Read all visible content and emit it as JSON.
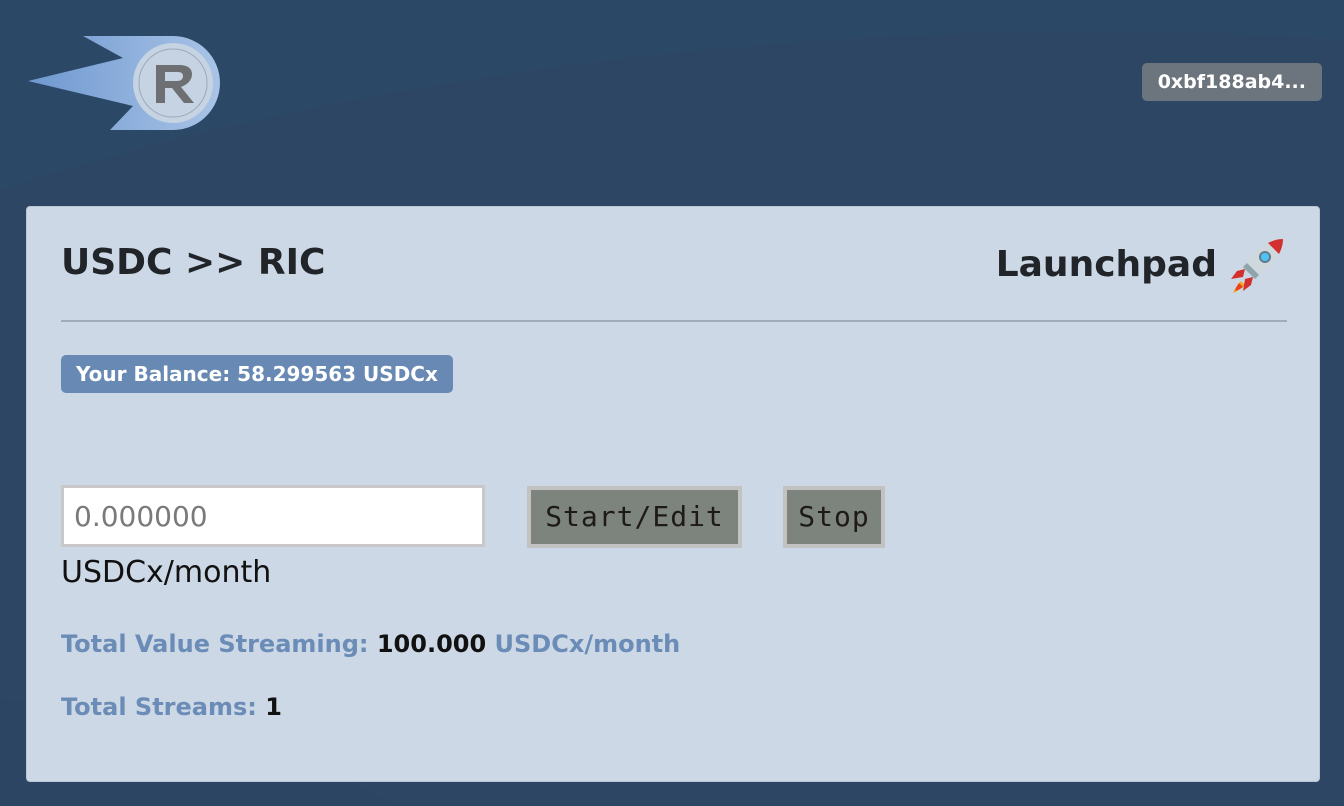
{
  "header": {
    "logo_icon": "ricochet-logo-icon",
    "wallet_address": "0xbf188ab4..."
  },
  "market": {
    "title": "USDC >> RIC",
    "launchpad_label": "Launchpad",
    "launchpad_icon": "rocket-icon",
    "balance_badge": "Your Balance: 58.299563 USDCx",
    "rate_input": {
      "placeholder": "0.000000",
      "value": ""
    },
    "rate_unit": "USDCx/month",
    "start_button": "Start/Edit",
    "stop_button": "Stop",
    "total_value_label": "Total Value Streaming:",
    "total_value": "100.000",
    "total_value_unit": "USDCx/month",
    "total_streams_label": "Total Streams:",
    "total_streams": "1"
  },
  "colors": {
    "page_background": "#2c4664",
    "card_background": "#ccd8e5",
    "accent_blue": "#6789b3",
    "wallet_button": "#6c757d",
    "action_button": "#7c847d"
  }
}
